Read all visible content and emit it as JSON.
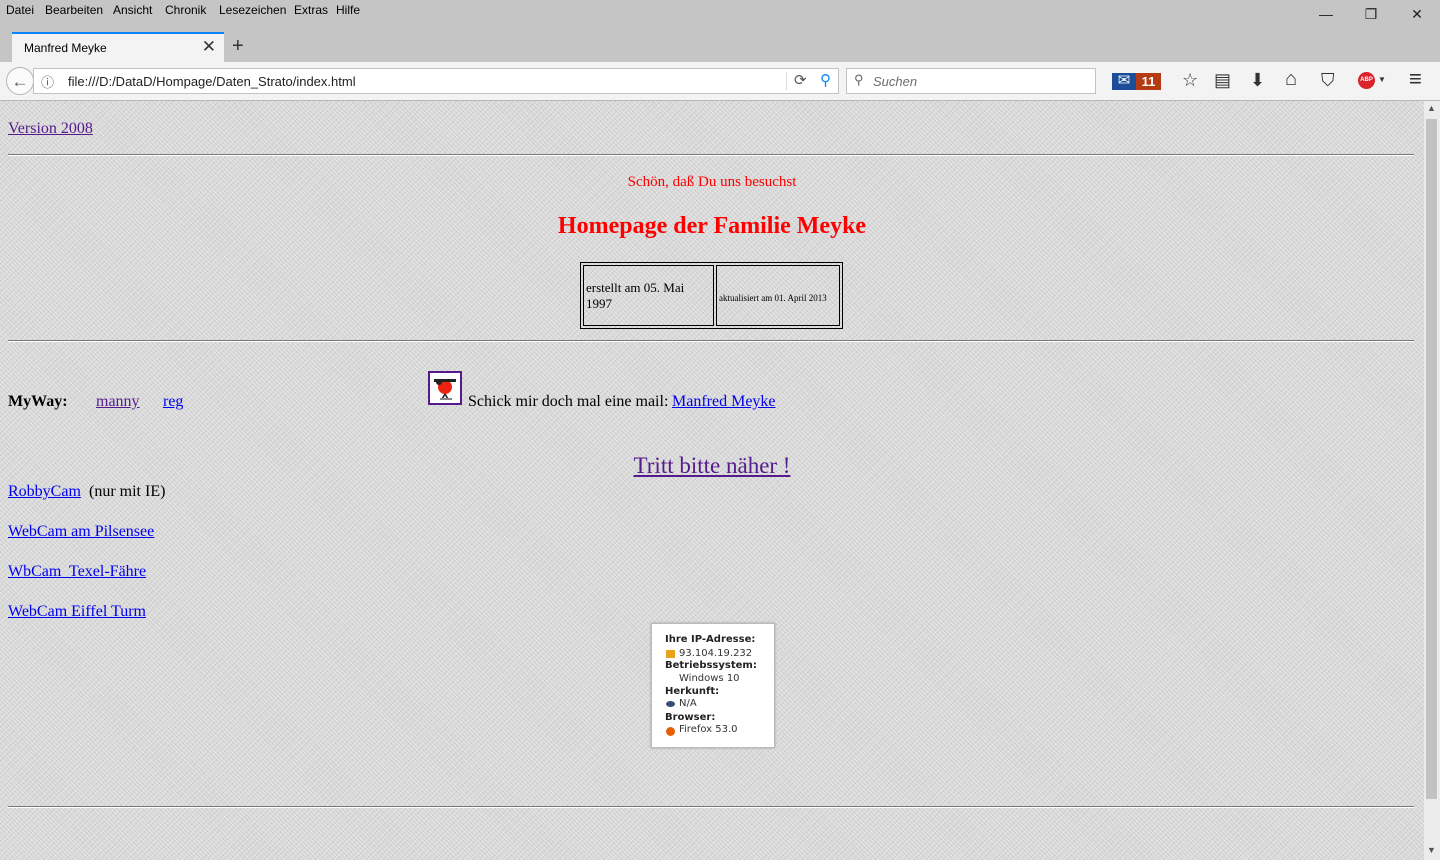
{
  "menu": [
    "Datei",
    "Bearbeiten",
    "Ansicht",
    "Chronik",
    "Lesezeichen",
    "Extras",
    "Hilfe"
  ],
  "window_controls": {
    "minimize": "—",
    "restore": "❐",
    "close": "✕"
  },
  "tab": {
    "title": "Manfred Meyke",
    "close": "✕",
    "new_tab": "+"
  },
  "nav": {
    "back": "←",
    "info": "ⓘ",
    "url": "file:///D:/DataD/Hompage/Daten_Strato/index.html",
    "reload": "⟳",
    "go": "⚲",
    "search_icon": "⚲",
    "search_placeholder": "Suchen",
    "mail_badge": "11",
    "mail_icon": "✉",
    "icons": {
      "bookmark": "☆",
      "reader": "▤",
      "download": "⬇",
      "home": "⌂",
      "pocket": "⛉",
      "abp": "ABP",
      "abp_arrow": "▼",
      "menu": "≡"
    }
  },
  "scroll": {
    "up": "▲",
    "down": "▼"
  },
  "page": {
    "version_link": "Version 2008",
    "greeting": "Schön, daß Du uns besuchst",
    "title": "Homepage der Familie Meyke",
    "created": "erstellt am 05. Mai 1997",
    "updated": "aktualisiert am 01. April 2013",
    "myway_label": "MyWay:",
    "myway_links": [
      "manny",
      "reg"
    ],
    "mail_text": "Schick mir doch mal eine mail:",
    "mail_link": "Manfred Meyke",
    "enter_link": "Tritt bitte näher !",
    "robbycam_link": "RobbyCam",
    "robbycam_note": "(nur mit IE)",
    "webcam_links": [
      "WebCam am Pilsensee",
      "WbCam  Texel-Fähre",
      "WebCam Eiffel Turm"
    ],
    "ipbox": {
      "ip_label": "Ihre IP-Adresse:",
      "ip_value": "93.104.19.232",
      "os_label": "Betriebssystem:",
      "os_value": "Windows 10",
      "origin_label": "Herkunft:",
      "origin_value": "N/A",
      "browser_label": "Browser:",
      "browser_value": "Firefox 53.0"
    }
  }
}
